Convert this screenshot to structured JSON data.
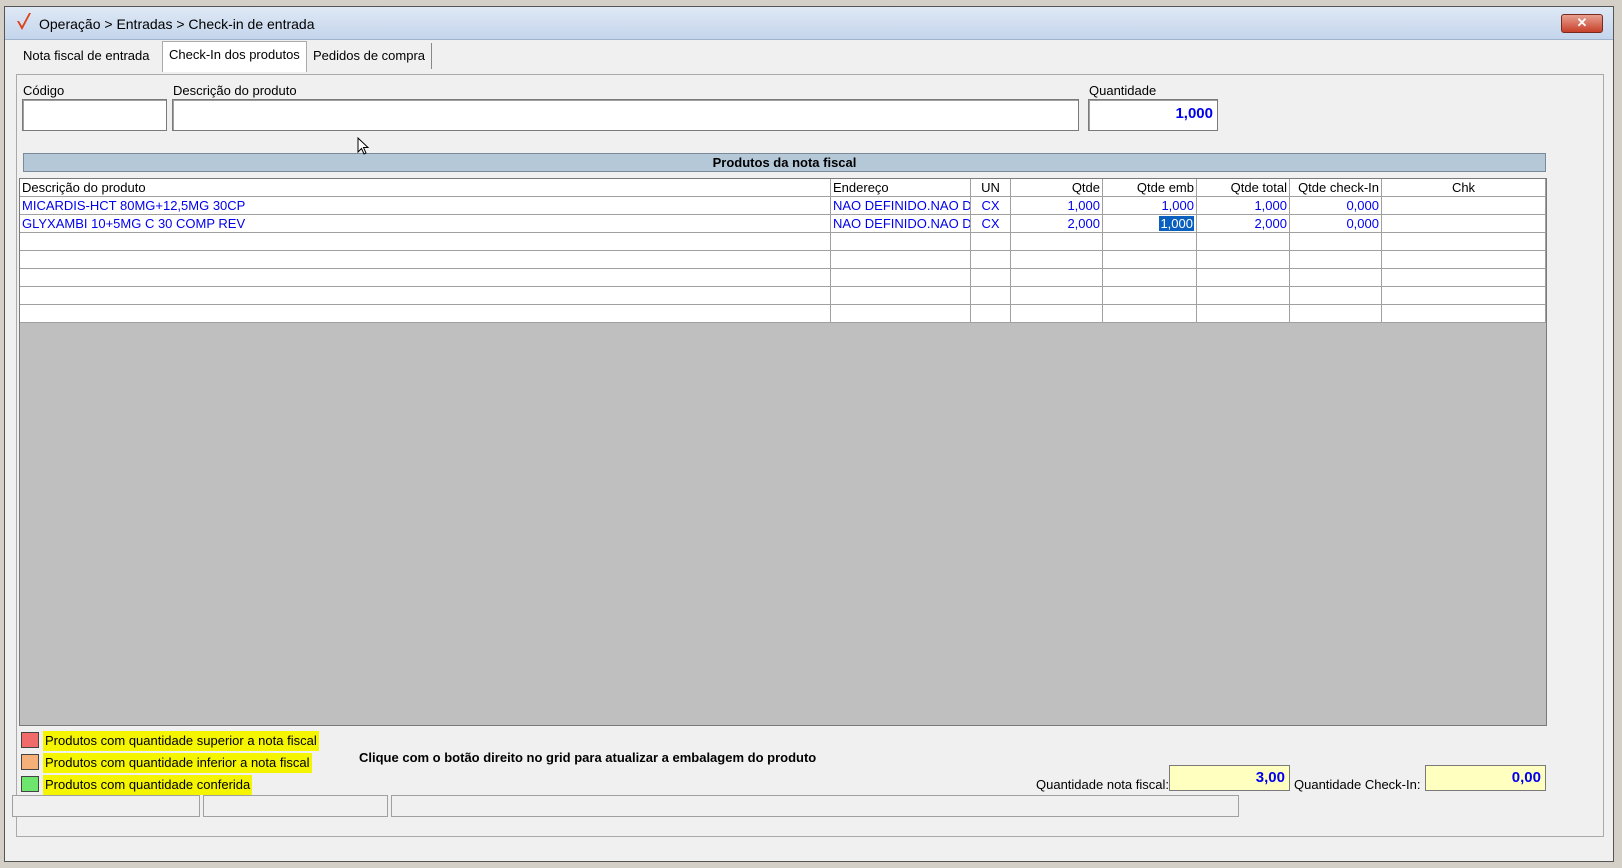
{
  "window": {
    "title": "Operação > Entradas > Check-in de entrada",
    "close_label": "✕"
  },
  "tabs": [
    {
      "label": "Nota fiscal de entrada"
    },
    {
      "label": "Check-In dos produtos"
    },
    {
      "label": "Pedidos de compra"
    }
  ],
  "form": {
    "codigo_label": "Código",
    "codigo_value": "",
    "descricao_label": "Descrição do produto",
    "descricao_value": "",
    "quantidade_label": "Quantidade",
    "quantidade_value": "1,000"
  },
  "grid": {
    "title": "Produtos da nota fiscal",
    "columns": [
      "Descrição do produto",
      "Endereço",
      "UN",
      "Qtde",
      "Qtde emb",
      "Qtde total",
      "Qtde check-In",
      "Chk"
    ],
    "rows": [
      {
        "descricao": "MICARDIS-HCT 80MG+12,5MG 30CP",
        "endereco": "NAO DEFINIDO.NAO D",
        "un": "CX",
        "qtde": "1,000",
        "qtde_emb": "1,000",
        "qtde_total": "1,000",
        "qtde_checkin": "0,000",
        "chk": ""
      },
      {
        "descricao": "GLYXAMBI 10+5MG C 30 COMP REV",
        "endereco": "NAO DEFINIDO.NAO D",
        "un": "CX",
        "qtde": "2,000",
        "qtde_emb": "1,000",
        "qtde_total": "2,000",
        "qtde_checkin": "0,000",
        "chk": ""
      }
    ]
  },
  "legend": [
    {
      "label": "Produtos com quantidade superior a nota fiscal",
      "color": "#f26b6b"
    },
    {
      "label": "Produtos com quantidade inferior a nota fiscal",
      "color": "#f5b07a"
    },
    {
      "label": "Produtos com quantidade conferida",
      "color": "#6ee66e"
    }
  ],
  "hint": "Clique com o botão direito no grid para atualizar a embalagem do produto",
  "totals": {
    "nota_fiscal_label": "Quantidade nota fiscal:",
    "nota_fiscal_value": "3,00",
    "checkin_label": "Quantidade Check-In:",
    "checkin_value": "0,00"
  },
  "colors": {
    "accent_text": "#0000ee",
    "legend_highlight": "#f5f500",
    "total_field_bg": "#ffffc0"
  }
}
